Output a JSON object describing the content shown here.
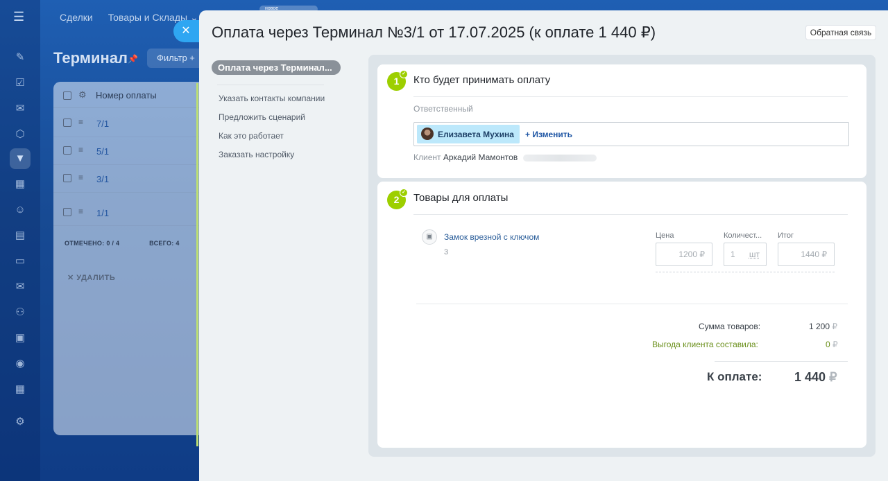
{
  "background_app": {
    "top_nav": [
      "Сделки",
      "Товары и Склады"
    ],
    "new_badge": "новое",
    "page_title": "Терминал",
    "filter_label": "Фильтр",
    "grid_header": "Номер оплаты",
    "rows": [
      "7/1",
      "5/1",
      "3/1",
      "1/1"
    ],
    "checked_label": "ОТМЕЧЕНО: 0 / 4",
    "total_label": "ВСЕГО: 4",
    "delete_label": "УДАЛИТЬ"
  },
  "panel": {
    "title": "Оплата через Терминал №3/1 от 17.07.2025 (к оплате 1 440 ₽)",
    "feedback_button": "Обратная связь"
  },
  "menu": {
    "active": "Оплата через Терминал",
    "items": [
      "Указать контакты компании",
      "Предложить сценарий",
      "Как это работает",
      "Заказать настройку"
    ]
  },
  "step1": {
    "number": "1",
    "title": "Кто будет принимать оплату",
    "responsible_label": "Ответственный",
    "responsible_name": "Елизавета Мухина",
    "change_label": "+ Изменить",
    "client_label": "Клиент",
    "client_name": "Аркадий Мамонтов"
  },
  "step2": {
    "number": "2",
    "title": "Товары для оплаты",
    "product_name": "Замок врезной с ключом",
    "product_sub": "3",
    "price_label": "Цена",
    "qty_label": "Количест...",
    "total_label": "Итог",
    "price_value": "1200",
    "price_currency": "₽",
    "qty_value": "1",
    "qty_unit": "шт",
    "total_value": "1440",
    "total_currency": "₽",
    "sum_label": "Сумма товаров:",
    "sum_value": "1 200",
    "benefit_label": "Выгода клиента составила:",
    "benefit_value": "0",
    "pay_label": "К оплате:",
    "pay_value": "1 440",
    "currency": "₽"
  },
  "colors": {
    "accent_green": "#9dcf00",
    "link_blue": "#2a5d99",
    "benefit_green": "#6a8f1a",
    "close_button": "#2fa6f2"
  }
}
